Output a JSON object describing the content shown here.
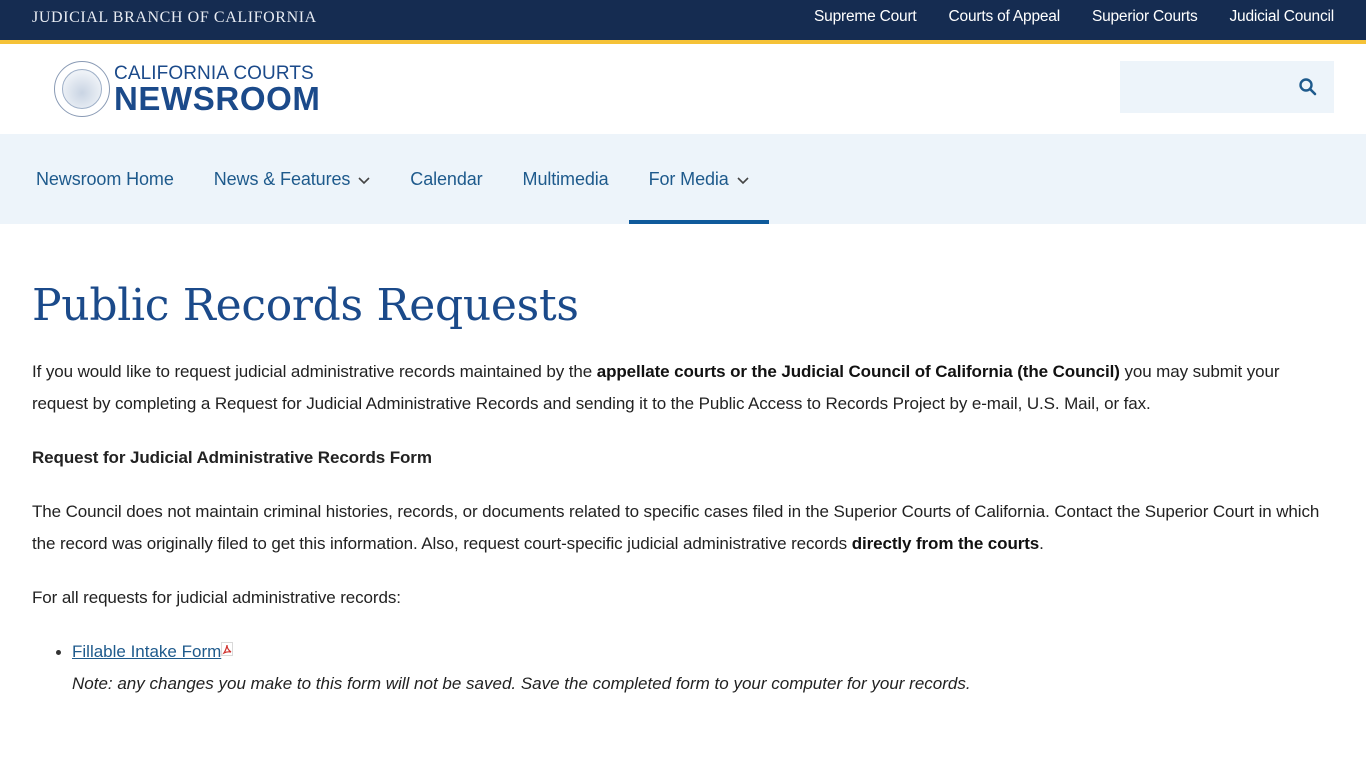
{
  "utility_bar": {
    "brand": "JUDICIAL BRANCH OF CALIFORNIA",
    "links": [
      "Supreme Court",
      "Courts of Appeal",
      "Superior Courts",
      "Judicial Council"
    ]
  },
  "header": {
    "logo_top": "CALIFORNIA COURTS",
    "logo_bottom": "NEWSROOM",
    "search": {
      "placeholder": "",
      "value": "",
      "icon": "search-icon"
    }
  },
  "nav": {
    "items": [
      {
        "label": "Newsroom Home",
        "dropdown": false
      },
      {
        "label": "News & Features",
        "dropdown": true
      },
      {
        "label": "Calendar",
        "dropdown": false
      },
      {
        "label": "Multimedia",
        "dropdown": false
      },
      {
        "label": "For Media",
        "dropdown": true,
        "active": true
      }
    ]
  },
  "page": {
    "title": "Public Records Requests",
    "intro_before": "If you would like to request judicial administrative records maintained by the ",
    "intro_bold": "appellate courts or the Judicial Council of California (the Council)",
    "intro_after": " you may submit your request by completing a Request for Judicial Administrative Records and sending it to the Public Access to Records Project by e-mail, U.S. Mail, or fax.",
    "form_heading": "Request for Judicial Administrative Records Form",
    "council_before": "The Council does not maintain criminal histories, records, or documents related to specific cases filed in the Superior Courts of California. Contact the Superior Court in which the record was originally filed to get this information. Also, request court-specific judicial administrative records ",
    "council_bold": "directly from the courts",
    "council_after": ".",
    "all_requests": "For all requests for judicial administrative records:",
    "list": [
      {
        "link": "Fillable Intake Form",
        "icon": "pdf-icon",
        "note": "Note: any changes you make to this form will not be saved. Save the completed form to your computer for your records."
      }
    ]
  },
  "colors": {
    "utility_bg": "#152c51",
    "gold_accent": "#f5c237",
    "brand_blue": "#1b4a8a",
    "nav_bg": "#edf4fa",
    "link_blue": "#1e5a8c",
    "active_bar": "#0f5a9b"
  }
}
